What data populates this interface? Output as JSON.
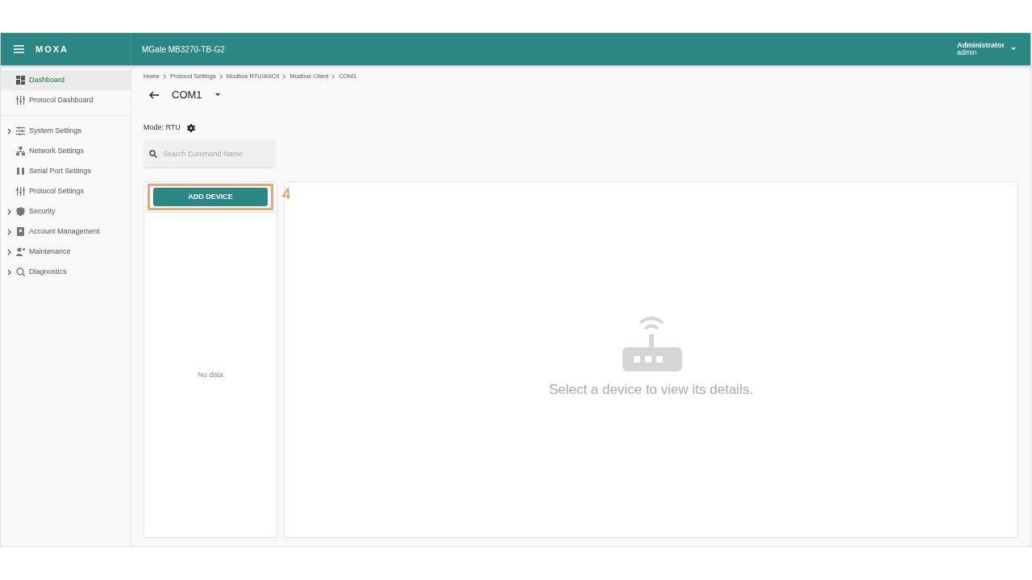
{
  "header": {
    "logo": "MOXA",
    "device": "MGate MB3270-TB-G2",
    "user": {
      "role": "Administrator",
      "name": "admin"
    }
  },
  "sidebar": {
    "groups": [
      {
        "items": [
          {
            "label": "Dashboard",
            "selected": true,
            "expandable": false
          },
          {
            "label": "Protocol Dashboard",
            "selected": false,
            "expandable": false
          }
        ]
      },
      {
        "items": [
          {
            "label": "System Settings",
            "selected": false,
            "expandable": true
          },
          {
            "label": "Network Settings",
            "selected": false,
            "expandable": false
          },
          {
            "label": "Serial Port Settings",
            "selected": false,
            "expandable": false
          },
          {
            "label": "Protocol Settings",
            "selected": false,
            "expandable": false
          },
          {
            "label": "Security",
            "selected": false,
            "expandable": true
          },
          {
            "label": "Account Management",
            "selected": false,
            "expandable": true
          },
          {
            "label": "Maintenance",
            "selected": false,
            "expandable": true
          },
          {
            "label": "Diagnostics",
            "selected": false,
            "expandable": true
          }
        ]
      }
    ]
  },
  "breadcrumb": [
    "Home",
    "Protocol Settings",
    "Modbus RTU/ASCII",
    "Modbus Client",
    "COM1"
  ],
  "page_title": "COM1",
  "mode": "Mode: RTU",
  "search": {
    "placeholder": "Search Command Name"
  },
  "device_list": {
    "add_button": "ADD DEVICE",
    "callout": "4",
    "empty_text": "No data"
  },
  "details": {
    "empty_text": "Select a device to view its details."
  }
}
